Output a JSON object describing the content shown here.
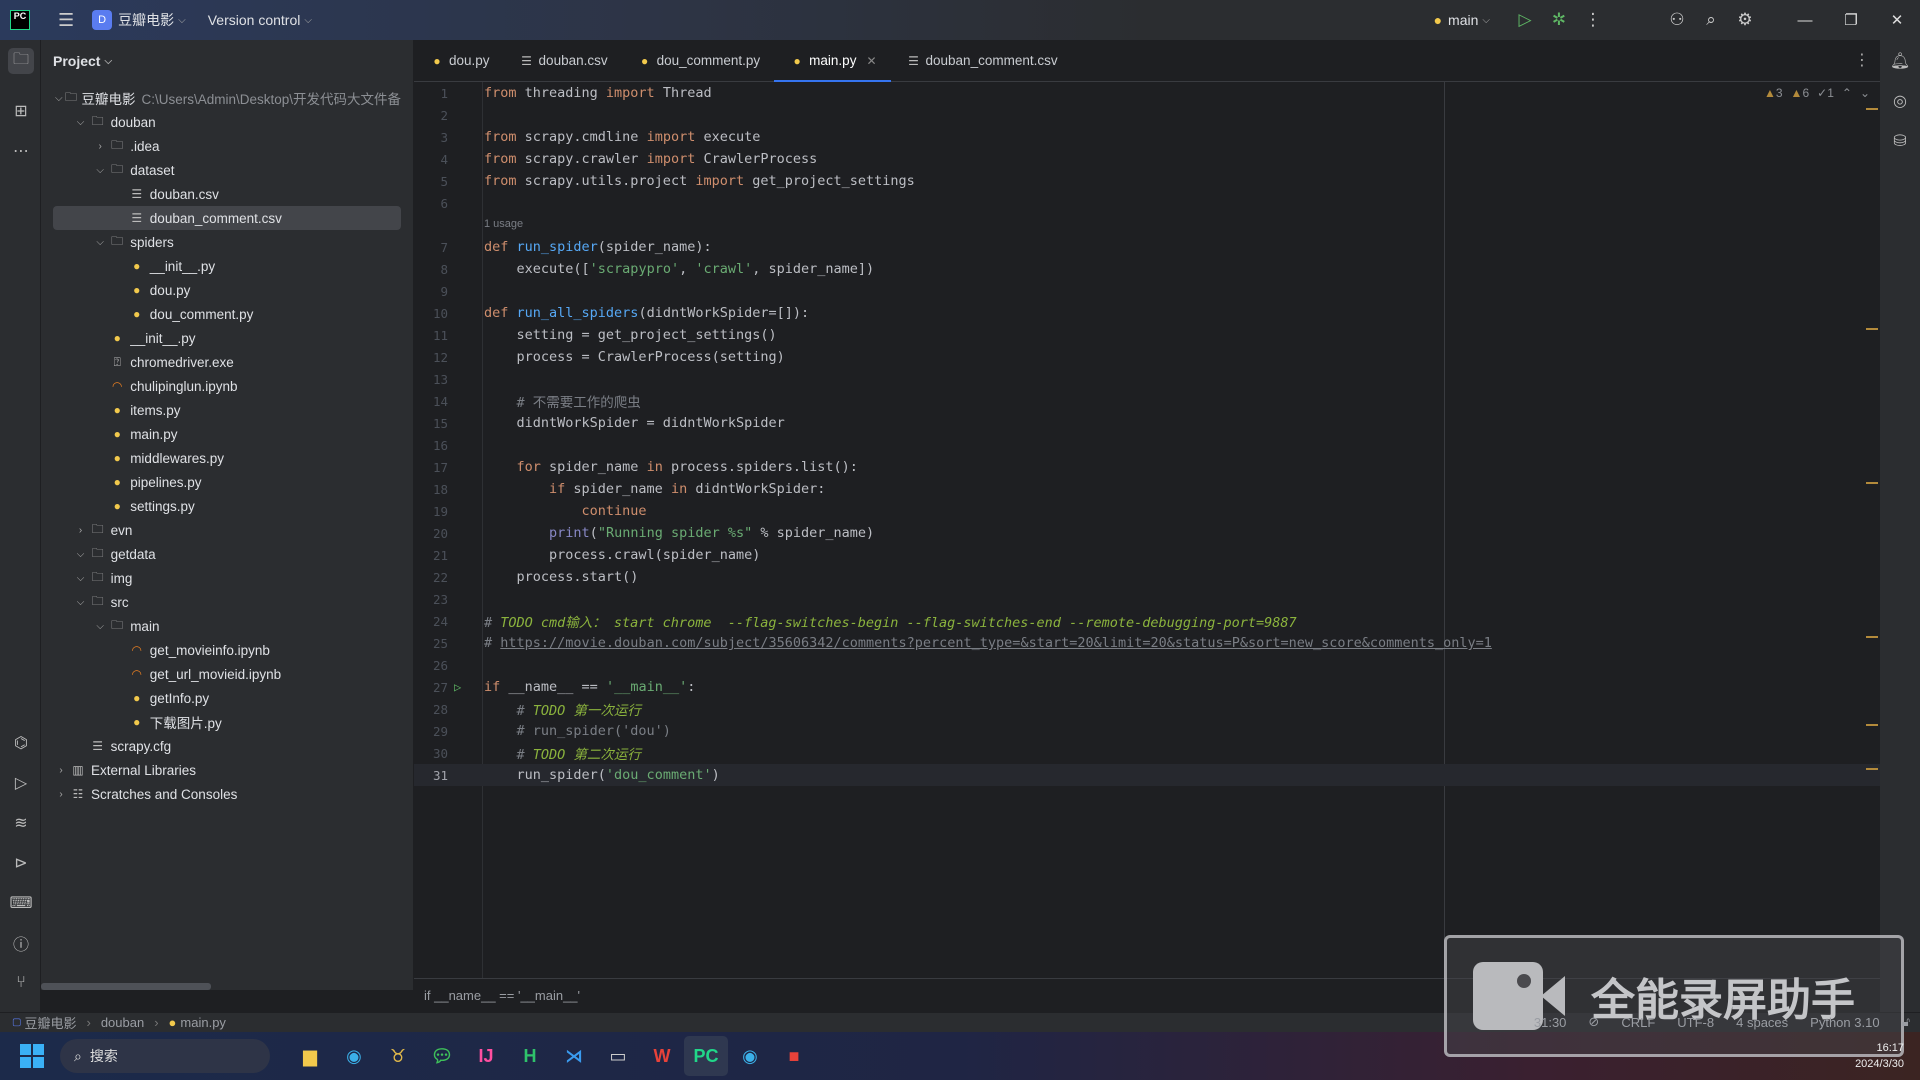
{
  "titlebar": {
    "project": "豆瓣电影",
    "project_badge": "D",
    "vcs": "Version control",
    "run_config": "main"
  },
  "sidebar_panel": {
    "title": "Project"
  },
  "tree": [
    {
      "depth": 0,
      "arrow": "down",
      "icon": "folder",
      "label": "豆瓣电影",
      "path": "C:\\Users\\Admin\\Desktop\\开发代码大文件备"
    },
    {
      "depth": 1,
      "arrow": "down",
      "icon": "folder",
      "label": "douban"
    },
    {
      "depth": 2,
      "arrow": "right",
      "icon": "folder",
      "label": ".idea"
    },
    {
      "depth": 2,
      "arrow": "down",
      "icon": "folder",
      "label": "dataset"
    },
    {
      "depth": 3,
      "arrow": "",
      "icon": "csv",
      "label": "douban.csv"
    },
    {
      "depth": 3,
      "arrow": "",
      "icon": "csv",
      "label": "douban_comment.csv",
      "selected": true
    },
    {
      "depth": 2,
      "arrow": "down",
      "icon": "folder",
      "label": "spiders"
    },
    {
      "depth": 3,
      "arrow": "",
      "icon": "py",
      "label": "__init__.py"
    },
    {
      "depth": 3,
      "arrow": "",
      "icon": "py",
      "label": "dou.py"
    },
    {
      "depth": 3,
      "arrow": "",
      "icon": "py",
      "label": "dou_comment.py"
    },
    {
      "depth": 2,
      "arrow": "",
      "icon": "py",
      "label": "__init__.py"
    },
    {
      "depth": 2,
      "arrow": "",
      "icon": "exe",
      "label": "chromedriver.exe"
    },
    {
      "depth": 2,
      "arrow": "",
      "icon": "nb",
      "label": "chulipinglun.ipynb"
    },
    {
      "depth": 2,
      "arrow": "",
      "icon": "py",
      "label": "items.py"
    },
    {
      "depth": 2,
      "arrow": "",
      "icon": "py",
      "label": "main.py"
    },
    {
      "depth": 2,
      "arrow": "",
      "icon": "py",
      "label": "middlewares.py"
    },
    {
      "depth": 2,
      "arrow": "",
      "icon": "py",
      "label": "pipelines.py"
    },
    {
      "depth": 2,
      "arrow": "",
      "icon": "py",
      "label": "settings.py"
    },
    {
      "depth": 1,
      "arrow": "right",
      "icon": "folder",
      "label": "evn"
    },
    {
      "depth": 1,
      "arrow": "down",
      "icon": "folder",
      "label": "getdata"
    },
    {
      "depth": 1,
      "arrow": "down",
      "icon": "folder",
      "label": "img"
    },
    {
      "depth": 1,
      "arrow": "down",
      "icon": "folder",
      "label": "src"
    },
    {
      "depth": 2,
      "arrow": "down",
      "icon": "folder",
      "label": "main"
    },
    {
      "depth": 3,
      "arrow": "",
      "icon": "nb",
      "label": "get_movieinfo.ipynb"
    },
    {
      "depth": 3,
      "arrow": "",
      "icon": "nb",
      "label": "get_url_movieid.ipynb"
    },
    {
      "depth": 3,
      "arrow": "",
      "icon": "py",
      "label": "getInfo.py"
    },
    {
      "depth": 3,
      "arrow": "",
      "icon": "py",
      "label": "下载图片.py"
    },
    {
      "depth": 1,
      "arrow": "",
      "icon": "cfg",
      "label": "scrapy.cfg"
    },
    {
      "depth": 0,
      "arrow": "right",
      "icon": "lib",
      "label": "External Libraries"
    },
    {
      "depth": 0,
      "arrow": "right",
      "icon": "scratch",
      "label": "Scratches and Consoles"
    }
  ],
  "tabs": [
    {
      "label": "dou.py",
      "icon": "py"
    },
    {
      "label": "douban.csv",
      "icon": "csv"
    },
    {
      "label": "dou_comment.py",
      "icon": "py"
    },
    {
      "label": "main.py",
      "icon": "py",
      "active": true
    },
    {
      "label": "douban_comment.csv",
      "icon": "csv"
    }
  ],
  "inspections": {
    "warnings": "3",
    "weak_warnings": "6",
    "typos": "1"
  },
  "usage_hint": "1 usage",
  "code": [
    [
      [
        "kw",
        "from "
      ],
      [
        "pl",
        "threading "
      ],
      [
        "kw",
        "import "
      ],
      [
        "pl",
        "Thread"
      ]
    ],
    [],
    [
      [
        "kw",
        "from "
      ],
      [
        "pl",
        "scrapy.cmdline "
      ],
      [
        "kw",
        "import "
      ],
      [
        "pl",
        "execute"
      ]
    ],
    [
      [
        "kw",
        "from "
      ],
      [
        "pl",
        "scrapy.crawler "
      ],
      [
        "kw",
        "import "
      ],
      [
        "pl",
        "CrawlerProcess"
      ]
    ],
    [
      [
        "kw",
        "from "
      ],
      [
        "pl",
        "scrapy.utils.project "
      ],
      [
        "kw",
        "import "
      ],
      [
        "pl",
        "get_project_settings"
      ]
    ],
    [],
    [
      [
        "kw",
        "def "
      ],
      [
        "fn",
        "run_spider"
      ],
      [
        "pl",
        "(spider_name):"
      ]
    ],
    [
      [
        "pl",
        "    execute(["
      ],
      [
        "str",
        "'scrapypro'"
      ],
      [
        "pl",
        ", "
      ],
      [
        "str",
        "'crawl'"
      ],
      [
        "pl",
        ", spider_name])"
      ]
    ],
    [],
    [
      [
        "kw",
        "def "
      ],
      [
        "fn",
        "run_all_spiders"
      ],
      [
        "pl",
        "(didntWorkSpider=[]):"
      ]
    ],
    [
      [
        "pl",
        "    setting = get_project_settings()"
      ]
    ],
    [
      [
        "pl",
        "    process = CrawlerProcess(setting)"
      ]
    ],
    [],
    [
      [
        "cm",
        "    # 不需要工作的爬虫"
      ]
    ],
    [
      [
        "pl",
        "    didntWorkSpider = didntWorkSpider"
      ]
    ],
    [],
    [
      [
        "kw",
        "    for "
      ],
      [
        "pl",
        "spider_name "
      ],
      [
        "kw",
        "in "
      ],
      [
        "pl",
        "process.spiders.list():"
      ]
    ],
    [
      [
        "kw",
        "        if "
      ],
      [
        "pl",
        "spider_name "
      ],
      [
        "kw",
        "in "
      ],
      [
        "pl",
        "didntWorkSpider:"
      ]
    ],
    [
      [
        "kw",
        "            continue"
      ]
    ],
    [
      [
        "bi",
        "        print"
      ],
      [
        "pl",
        "("
      ],
      [
        "str",
        "\"Running spider %s\""
      ],
      [
        "pl",
        " % spider_name)"
      ]
    ],
    [
      [
        "pl",
        "        process.crawl(spider_name)"
      ]
    ],
    [
      [
        "pl",
        "    process.start()"
      ]
    ],
    [],
    [
      [
        "cm",
        "# "
      ],
      [
        "todo",
        "TODO cmd输入： start chrome  --flag-switches-begin --flag-switches-end --remote-debugging-port=9887"
      ]
    ],
    [
      [
        "cm",
        "# "
      ],
      [
        "lnk",
        "https://movie.douban.com/subject/35606342/comments?percent_type=&start=20&limit=20&status=P&sort=new_score&comments_only=1"
      ]
    ],
    [],
    [
      [
        "kw",
        "if "
      ],
      [
        "pl",
        "__name__ == "
      ],
      [
        "str",
        "'__main__'"
      ],
      [
        "pl",
        ":"
      ]
    ],
    [
      [
        "cm",
        "    # "
      ],
      [
        "todo",
        "TODO 第一次运行"
      ]
    ],
    [
      [
        "cm",
        "    # run_spider('dou')"
      ]
    ],
    [
      [
        "cm",
        "    # "
      ],
      [
        "todo",
        "TODO 第二次运行"
      ]
    ],
    [
      [
        "pl",
        "    run_spider("
      ],
      [
        "str",
        "'dou_comment'"
      ],
      [
        "pl",
        ")"
      ]
    ]
  ],
  "current_line": 31,
  "editor_breadcrumb": "if __name__ == '__main__'",
  "nav_path": [
    "豆瓣电影",
    "douban",
    "main.py"
  ],
  "status": {
    "position": "31:30",
    "line_sep": "CRLF",
    "encoding": "UTF-8",
    "indent": "4 spaces",
    "interpreter": "Python 3.10"
  },
  "taskbar": {
    "search": "搜索",
    "time": "16:17",
    "date": "2024/3/30"
  },
  "watermark": "全能录屏助手",
  "colors": {
    "accent": "#3574f0",
    "run": "#5fb865",
    "keyword": "#cf8e6d",
    "string": "#6aab73",
    "function": "#56a8f5"
  }
}
